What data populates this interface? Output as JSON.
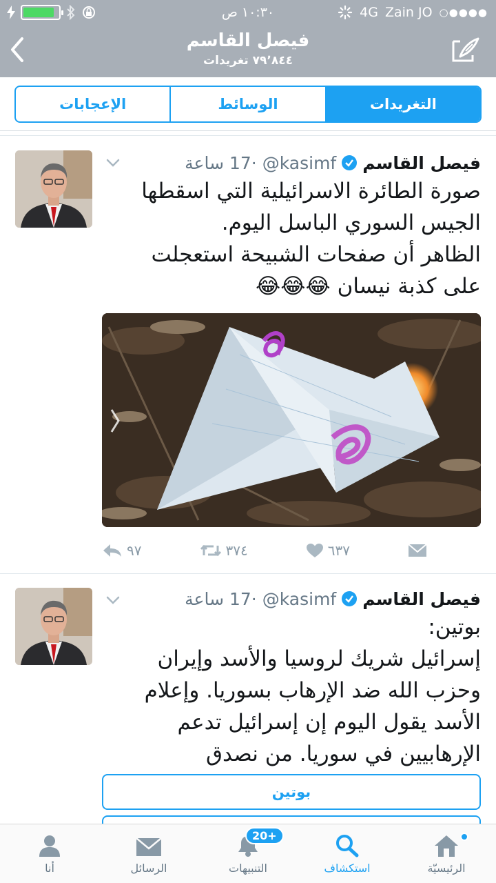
{
  "status_bar": {
    "time": "١٠:٣٠ ص",
    "network": "4G",
    "carrier": "Zain JO",
    "signal_dots": "○●●●●"
  },
  "nav": {
    "title": "فيصل القاسم",
    "subtitle": "٧٩٬٨٤٤ تغريدات"
  },
  "segments": [
    {
      "label": "الإعجابات"
    },
    {
      "label": "الوسائط"
    },
    {
      "label": "التغريدات",
      "active": true
    }
  ],
  "tweets": [
    {
      "name": "فيصل القاسم",
      "handle": "@kasimf",
      "time": "17 ساعة",
      "text_lines": [
        "صورة الطائرة الاسرائيلية التي اسقطها",
        "الجيس السوري الباسل اليوم.",
        "الظاهر أن  صفحات الشبيحة استعجلت",
        "على كذبة نيسان 😂😂😂"
      ],
      "replies": "٩٧",
      "retweets": "٣٧٤",
      "likes": "٦٣٧"
    },
    {
      "name": "فيصل القاسم",
      "handle": "@kasimf",
      "time": "17 ساعة",
      "text_lines": [
        "بوتين:",
        "إسرائيل شريك لروسيا والأسد وإيران",
        "وحزب الله ضد الإرهاب بسوريا. وإعلام",
        "الأسد يقول اليوم إن إسرائيل تدعم",
        "الإرهابيين في سوريا. من نصدق"
      ],
      "poll_option": "بوتين"
    }
  ],
  "tabbar": {
    "items": [
      {
        "label": "أنا"
      },
      {
        "label": "الرسائل"
      },
      {
        "label": "التنبيهات",
        "badge": "20+"
      },
      {
        "label": "استكشاف",
        "active": true
      },
      {
        "label": "الرئيسيّة"
      }
    ]
  },
  "colors": {
    "accent": "#1da1f2",
    "header_bg": "#a8afb7",
    "muted": "#657786",
    "battery": "#4cd964"
  }
}
